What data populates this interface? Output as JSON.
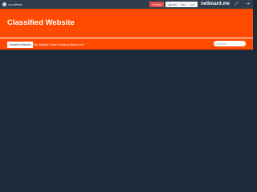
{
  "topbar": {
    "username": "crocodiledev",
    "follow_label": "Follow",
    "stats": [
      {
        "icon": "eye-icon",
        "value": "1730"
      },
      {
        "icon": "heart-icon",
        "value": "11"
      },
      {
        "icon": "comment-icon",
        "value": "0"
      }
    ],
    "brand": "netboard.me",
    "icons": [
      "expand-icon",
      "login-icon"
    ]
  },
  "header": {
    "title": "Classified Website"
  },
  "nav": {
    "items": [
      {
        "label": "Classified Website",
        "active": true
      },
      {
        "label": "The Ultimate Guide to Making Money from",
        "active": false
      }
    ]
  },
  "search": {
    "placeholder": "Search"
  },
  "colors": {
    "topbar": "#2f3d4f",
    "header": "#ff4a00",
    "content_bg": "#1c2a3b",
    "follow_button": "#e04b44"
  }
}
